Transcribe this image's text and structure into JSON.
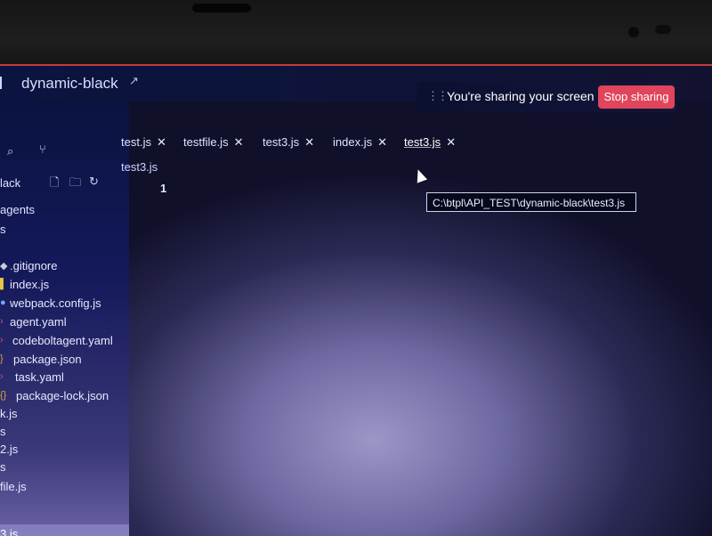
{
  "window": {
    "title": "dynamic-black",
    "accent_color": "#e0455b"
  },
  "share_banner": {
    "message": "You're sharing your screen",
    "stop_label": "Stop sharing"
  },
  "sidebar": {
    "explorer_label": "lack",
    "section_label": "agents",
    "files": [
      {
        "name": ".gitignore",
        "icon": "gitignore-icon",
        "color": "#c9c9d9"
      },
      {
        "name": "index.js",
        "icon": "js-file-icon",
        "color": "#e8c547"
      },
      {
        "name": "webpack.config.js",
        "icon": "webpack-icon",
        "color": "#6fa8ff"
      },
      {
        "name": "agent.yaml",
        "icon": "yaml-icon",
        "color": "#c05a7a"
      },
      {
        "name": "codeboltagent.yaml",
        "icon": "yaml-icon",
        "color": "#c05a7a"
      },
      {
        "name": "package.json",
        "icon": "json-icon",
        "color": "#d9a340"
      },
      {
        "name": "task.yaml",
        "icon": "yaml-icon",
        "color": "#c05a7a"
      },
      {
        "name": "package-lock.json",
        "icon": "json-icon",
        "color": "#d9a340"
      }
    ],
    "cut_items": [
      "s",
      "k.js",
      "s",
      "2.js",
      "s",
      "file.js",
      "3.js"
    ]
  },
  "tabs": [
    {
      "label": "test.js"
    },
    {
      "label": "testfile.js"
    },
    {
      "label": "test3.js"
    },
    {
      "label": "index.js"
    },
    {
      "label": "test3.js",
      "active": true
    }
  ],
  "editor": {
    "breadcrumb": "test3.js",
    "line_number": "1",
    "tooltip": "C:\\btpl\\API_TEST\\dynamic-black\\test3.js"
  }
}
